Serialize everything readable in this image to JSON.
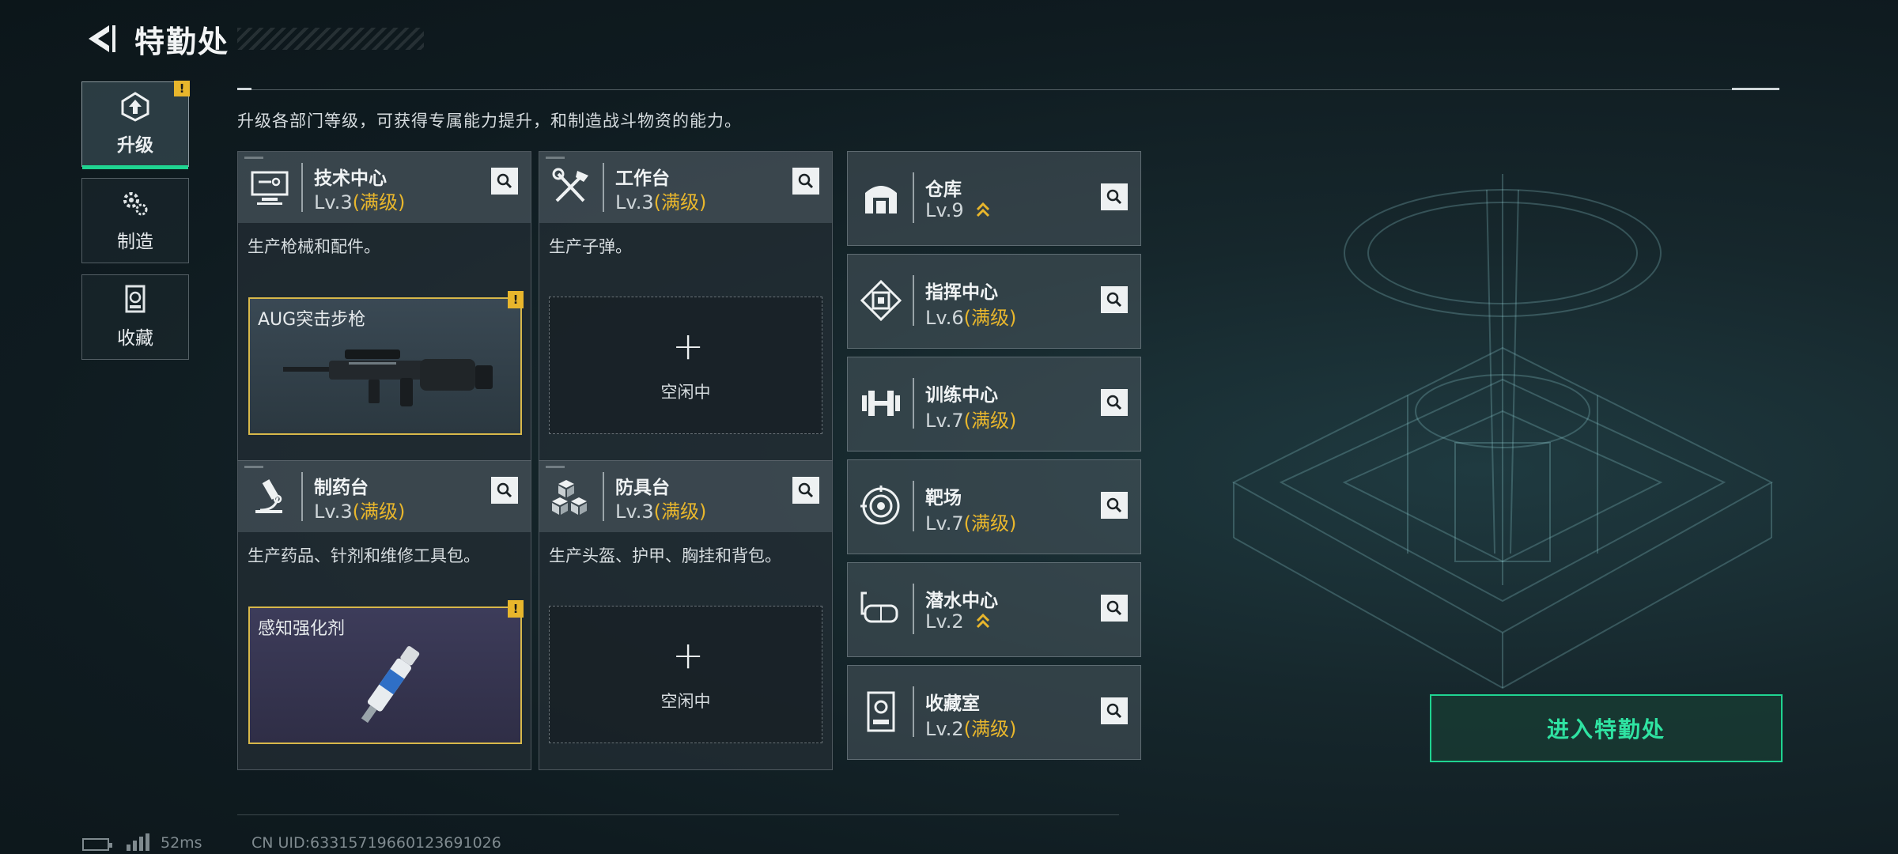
{
  "header": {
    "title": "特勤处"
  },
  "nav": [
    {
      "label": "升级",
      "icon": "upgrade-icon",
      "active": true,
      "badge": "!"
    },
    {
      "label": "制造",
      "icon": "gears-icon",
      "active": false
    },
    {
      "label": "收藏",
      "icon": "collection-icon",
      "active": false
    }
  ],
  "intro": "升级各部门等级，可获得专属能力提升，和制造战斗物资的能力。",
  "departments": [
    {
      "name": "技术中心",
      "level": "Lv.3",
      "level_tag": "(满级)",
      "desc": "生产枪械和配件。",
      "icon": "monitor-icon",
      "slot": {
        "type": "item",
        "item_name": "AUG突击步枪",
        "badge": "!"
      }
    },
    {
      "name": "工作台",
      "level": "Lv.3",
      "level_tag": "(满级)",
      "desc": "生产子弹。",
      "icon": "tools-icon",
      "slot": {
        "type": "empty",
        "status": "空闲中"
      }
    },
    {
      "name": "制药台",
      "level": "Lv.3",
      "level_tag": "(满级)",
      "desc": "生产药品、针剂和维修工具包。",
      "icon": "microscope-icon",
      "slot": {
        "type": "item",
        "item_name": "感知强化剂",
        "badge": "!"
      }
    },
    {
      "name": "防具台",
      "level": "Lv.3",
      "level_tag": "(满级)",
      "desc": "生产头盔、护甲、胸挂和背包。",
      "icon": "cubes-icon",
      "slot": {
        "type": "empty",
        "status": "空闲中"
      }
    }
  ],
  "facilities": [
    {
      "name": "仓库",
      "level": "Lv.9",
      "level_tag": "",
      "upgradable": true,
      "icon": "warehouse-icon"
    },
    {
      "name": "指挥中心",
      "level": "Lv.6",
      "level_tag": "(满级)",
      "upgradable": false,
      "icon": "command-icon"
    },
    {
      "name": "训练中心",
      "level": "Lv.7",
      "level_tag": "(满级)",
      "upgradable": false,
      "icon": "dumbbell-icon"
    },
    {
      "name": "靶场",
      "level": "Lv.7",
      "level_tag": "(满级)",
      "upgradable": false,
      "icon": "target-icon"
    },
    {
      "name": "潜水中心",
      "level": "Lv.2",
      "level_tag": "",
      "upgradable": true,
      "icon": "diving-mask-icon"
    },
    {
      "name": "收藏室",
      "level": "Lv.2",
      "level_tag": "(满级)",
      "upgradable": false,
      "icon": "trophy-case-icon"
    }
  ],
  "enter_button": "进入特勤处",
  "status": {
    "ping": "52ms",
    "uid": "CN UID:6331571966012369102​6"
  },
  "colors": {
    "accent": "#1fd491",
    "max_level": "#e8b62c",
    "badge": "#e8b62c"
  }
}
